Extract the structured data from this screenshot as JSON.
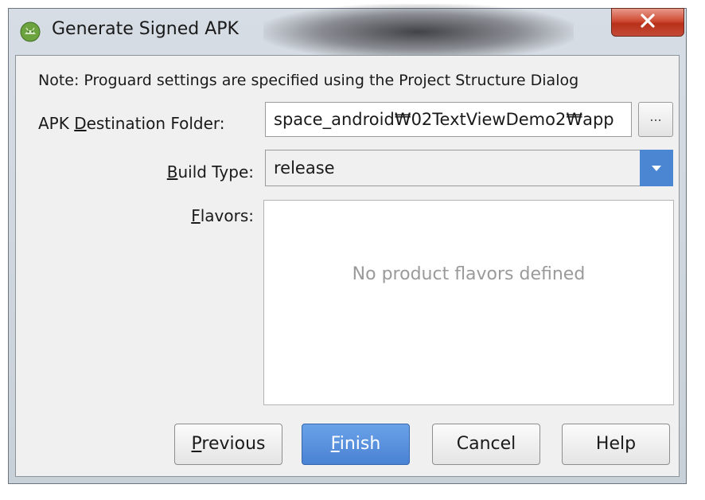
{
  "window": {
    "title": "Generate Signed APK"
  },
  "form": {
    "note": "Note: Proguard settings are specified using the Project Structure Dialog",
    "destination_label_pre": "APK ",
    "destination_label_mnemonic": "D",
    "destination_label_post": "estination Folder:",
    "destination_value": "space_android₩02TextViewDemo2₩app",
    "browse_label": "...",
    "build_type_label_mnemonic": "B",
    "build_type_label_post": "uild Type:",
    "build_type_value": "release",
    "flavors_label_mnemonic": "F",
    "flavors_label_post": "lavors:",
    "flavors_empty": "No product flavors defined"
  },
  "buttons": {
    "previous_mnemonic": "P",
    "previous_rest": "revious",
    "finish_mnemonic": "F",
    "finish_rest": "inish",
    "cancel": "Cancel",
    "help": "Help"
  },
  "icons": {
    "app": "android-studio-icon",
    "close": "close-icon",
    "dropdown": "chevron-down-icon"
  },
  "colors": {
    "primary_button": "#4a82d4",
    "close_button": "#c44b37",
    "dropdown_button": "#4a86d2"
  }
}
